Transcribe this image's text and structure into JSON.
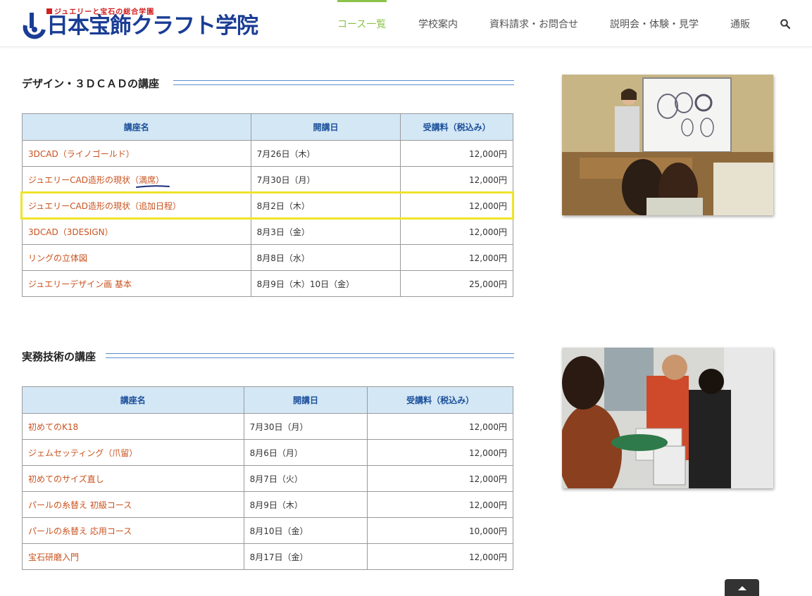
{
  "header": {
    "logo_tagline": "ジュエリーと宝石の総合学園",
    "logo_name": "日本宝飾クラフト学院",
    "nav": [
      {
        "label": "コース一覧",
        "active": true
      },
      {
        "label": "学校案内",
        "active": false
      },
      {
        "label": "資料請求・お問合せ",
        "active": false
      },
      {
        "label": "説明会・体験・見学",
        "active": false
      },
      {
        "label": "通販",
        "active": false
      }
    ],
    "accent_color": "#8bc34a"
  },
  "sections": [
    {
      "title": "デザイン・３ＤＣＡＤの講座",
      "headers": [
        "講座名",
        "開講日",
        "受講料（税込み）"
      ],
      "rows": [
        {
          "name": "3DCAD（ライノゴールド）",
          "date": "7月26日（木）",
          "fee": "12,000円"
        },
        {
          "name": "ジュエリーCAD造形の現状（満席）",
          "date": "7月30日（月）",
          "fee": "12,000円"
        },
        {
          "name": "ジュエリーCAD造形の現状（追加日程）",
          "date": "8月2日（木）",
          "fee": "12,000円"
        },
        {
          "name": "3DCAD（3DESIGN）",
          "date": "8月3日（金）",
          "fee": "12,000円"
        },
        {
          "name": "リングの立体図",
          "date": "8月8日（水）",
          "fee": "12,000円"
        },
        {
          "name": "ジュエリーデザイン画 基本",
          "date": "8月9日（木）10日（金）",
          "fee": "25,000円"
        }
      ]
    },
    {
      "title": "実務技術の講座",
      "headers": [
        "講座名",
        "開講日",
        "受講料（税込み）"
      ],
      "rows": [
        {
          "name": "初めてのK18",
          "date": "7月30日（月）",
          "fee": "12,000円"
        },
        {
          "name": "ジェムセッティング（爪留）",
          "date": "8月6日（月）",
          "fee": "12,000円"
        },
        {
          "name": "初めてのサイズ直し",
          "date": "8月7日（火）",
          "fee": "12,000円"
        },
        {
          "name": "パールの糸替え 初級コース",
          "date": "8月9日（木）",
          "fee": "12,000円"
        },
        {
          "name": "パールの糸替え 応用コース",
          "date": "8月10日（金）",
          "fee": "10,000円"
        },
        {
          "name": "宝石研磨入門",
          "date": "8月17日（金）",
          "fee": "12,000円"
        }
      ]
    }
  ],
  "colors": {
    "table_header_bg": "#d4e7f5",
    "course_name": "#c8521e",
    "highlight": "#f0e32a",
    "logo_blue": "#1a3d95"
  }
}
